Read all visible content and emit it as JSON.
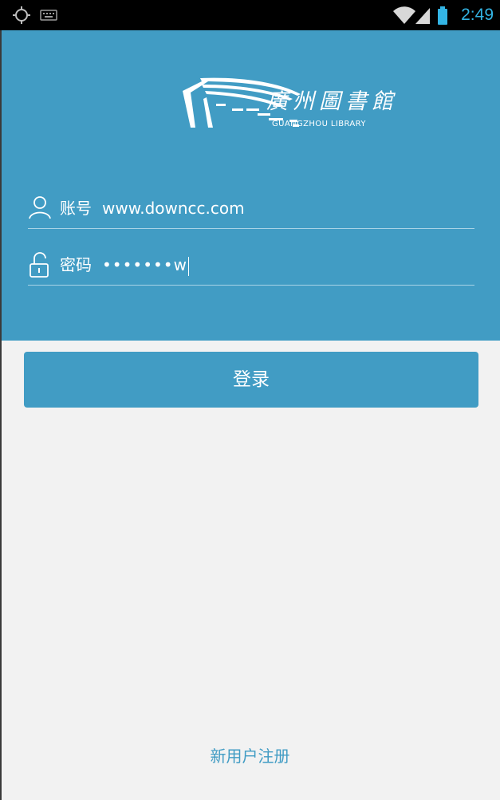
{
  "status_bar": {
    "time": "2:49",
    "icons": [
      "gps-icon",
      "keyboard-icon",
      "wifi-icon",
      "signal-icon",
      "battery-icon"
    ]
  },
  "logo": {
    "name_cn": "廣州圖書館",
    "name_en": "GUANGZHOU LIBRARY"
  },
  "login_form": {
    "account_label": "账号",
    "account_value": "www.downcc.com",
    "password_label": "密码",
    "password_masked": "•••••••",
    "password_last_char": "w",
    "login_button": "登录"
  },
  "register_link": "新用户注册",
  "colors": {
    "primary": "#419cc4",
    "background": "#f2f2f2",
    "status_bar": "#000000",
    "clock": "#33b5e5"
  }
}
